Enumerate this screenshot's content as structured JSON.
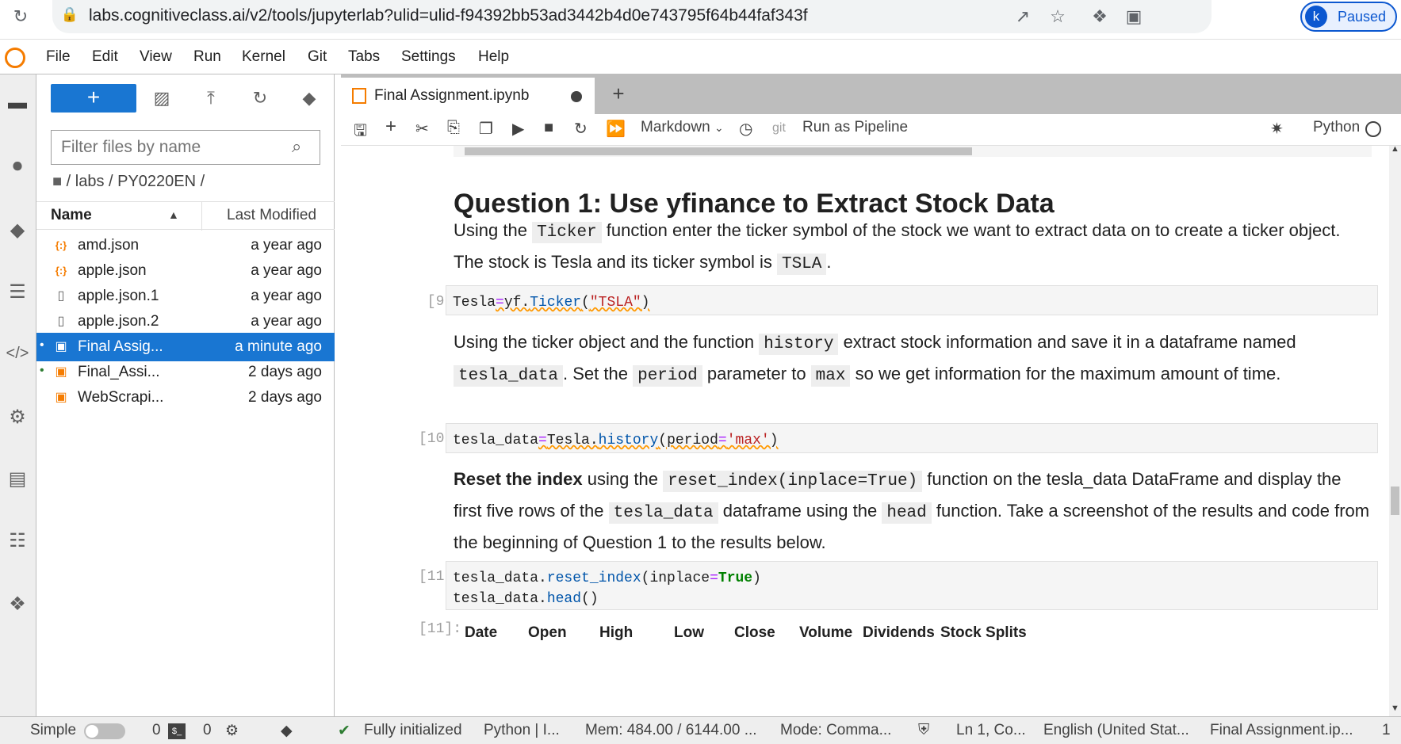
{
  "browser": {
    "url": "labs.cognitiveclass.ai/v2/tools/jupyterlab?ulid=ulid-f94392bb53ad3442b4d0e743795f64b44faf343f",
    "profile_initial": "k",
    "profile_status": "Paused"
  },
  "menu": [
    "File",
    "Edit",
    "View",
    "Run",
    "Kernel",
    "Git",
    "Tabs",
    "Settings",
    "Help"
  ],
  "filebrowser": {
    "new_label": "+",
    "filter_placeholder": "Filter files by name",
    "breadcrumb": "/ labs / PY0220EN /",
    "col_name": "Name",
    "col_modified": "Last Modified",
    "files": [
      {
        "name": "amd.json",
        "modified": "a year ago",
        "icon": "json-icon",
        "selected": false,
        "running": false
      },
      {
        "name": "apple.json",
        "modified": "a year ago",
        "icon": "json-icon",
        "selected": false,
        "running": false
      },
      {
        "name": "apple.json.1",
        "modified": "a year ago",
        "icon": "file-icon",
        "selected": false,
        "running": false
      },
      {
        "name": "apple.json.2",
        "modified": "a year ago",
        "icon": "file-icon",
        "selected": false,
        "running": false
      },
      {
        "name": "Final Assig...",
        "modified": "a minute ago",
        "icon": "notebook-icon",
        "selected": true,
        "running": true
      },
      {
        "name": "Final_Assi...",
        "modified": "2 days ago",
        "icon": "notebook-icon",
        "selected": false,
        "running": true
      },
      {
        "name": "WebScrapi...",
        "modified": "2 days ago",
        "icon": "notebook-icon",
        "selected": false,
        "running": false
      }
    ]
  },
  "tab": {
    "label": "Final Assignment.ipynb",
    "plus": "+"
  },
  "toolbar": {
    "cell_type": "Markdown",
    "git": "git",
    "pipeline": "Run as Pipeline",
    "kernel": "Python"
  },
  "notebook": {
    "heading": "Question 1: Use yfinance to Extract Stock Data",
    "md1": {
      "a": "Using the ",
      "code1": "Ticker",
      "b": " function enter the ticker symbol of the stock we want to extract data on to create a ticker object. The stock is Tesla and its ticker symbol is ",
      "code2": "TSLA",
      "c": "."
    },
    "cell9": {
      "prompt": "[9]:",
      "var": "Tesla",
      "eq": "=",
      "mod": "yf.",
      "fn": "Ticker",
      "open": "(",
      "str": "\"TSLA\"",
      "close": ")"
    },
    "md2": {
      "a": "Using the ticker object and the function ",
      "code1": "history",
      "b": " extract stock information and save it in a dataframe named ",
      "code2": "tesla_data",
      "c": ". Set the ",
      "code3": "period",
      "d": " parameter to ",
      "code4": "max",
      "e": " so we get information for the maximum amount of time."
    },
    "cell10": {
      "prompt": "[10]:",
      "var": "tesla_data",
      "eq": "=",
      "obj": "Tesla.",
      "fn": "history",
      "open": "(",
      "param": "period",
      "eq2": "=",
      "str": "'max'",
      "close": ")"
    },
    "md3": {
      "bold": "Reset the index",
      "a": " using the ",
      "code1": "reset_index(inplace=True)",
      "b": " function on the tesla_data DataFrame and display the first five rows of the ",
      "code2": "tesla_data",
      "c": " dataframe using the ",
      "code3": "head",
      "d": " function. Take a screenshot of the results and code from the beginning of Question 1 to the results below."
    },
    "cell11": {
      "prompt": "[11]:",
      "l1_obj": "tesla_data.",
      "l1_fn": "reset_index",
      "l1_open": "(inplace",
      "l1_eq": "=",
      "l1_kw": "True",
      "l1_close": ")",
      "l2_obj": "tesla_data.",
      "l2_fn": "head",
      "l2_rest": "()"
    },
    "out_prompt": "[11]:",
    "out_columns": [
      "Date",
      "Open",
      "High",
      "Low",
      "Close",
      "Volume",
      "Dividends",
      "Stock Splits"
    ]
  },
  "status": {
    "mode": "Simple",
    "terminals": "0",
    "kernels": "0",
    "init": "Fully initialized",
    "kernel": "Python | I...",
    "mem": "Mem: 484.00 / 6144.00 ...",
    "cmd_mode": "Mode: Comma...",
    "cursor": "Ln 1, Co...",
    "lang": "English (United Stat...",
    "file": "Final Assignment.ip...",
    "num": "1"
  }
}
